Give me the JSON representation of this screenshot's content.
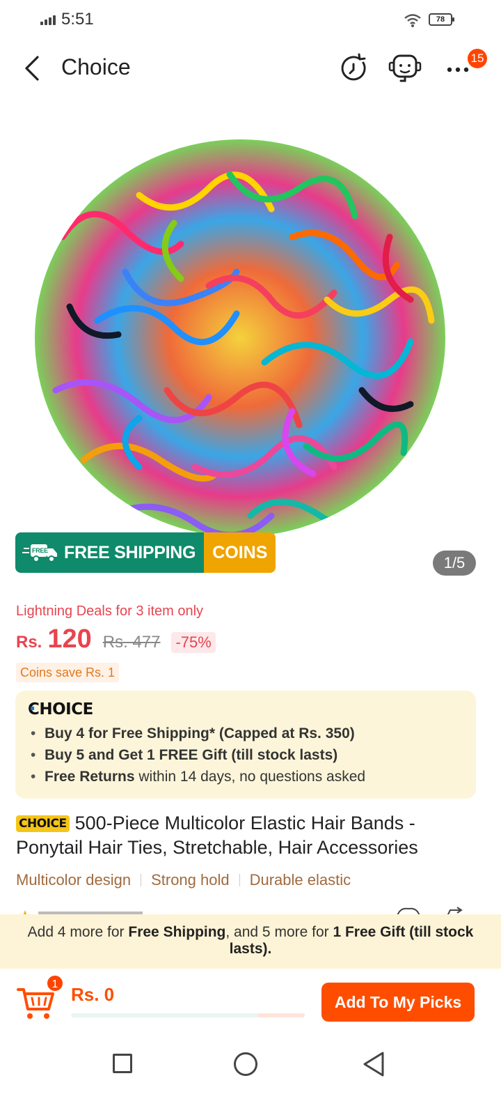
{
  "status_bar": {
    "time": "5:51",
    "battery": "78"
  },
  "header": {
    "title": "Choice",
    "badge_count": "15"
  },
  "gallery": {
    "counter": "1/5",
    "free_tag": "FREE",
    "free_shipping": "FREE SHIPPING",
    "coins": "COINS"
  },
  "price": {
    "deal_text": "Lightning Deals for 3 item only",
    "currency": "Rs.",
    "current": "120",
    "original": "Rs. 477",
    "discount": "-75%",
    "coins_save": "Coins save Rs. 1"
  },
  "choice_box": {
    "logo": "CHOICE",
    "items": [
      {
        "bold": "Buy 4 for  Free Shipping* (Capped at Rs. 350)",
        "rest": ""
      },
      {
        "bold": "Buy 5 and Get 1 FREE Gift (till stock lasts)",
        "rest": ""
      },
      {
        "bold": "Free Returns",
        "rest": " within 14 days, no questions asked"
      }
    ]
  },
  "product": {
    "tag": "CHOICE",
    "title": "500-Piece Multicolor Elastic Hair Bands - Ponytail Hair Ties, Stretchable, Hair Accessories",
    "features": [
      "Multicolor design",
      "Strong hold",
      "Durable elastic"
    ]
  },
  "bottom_promo": {
    "part1": "Add 4 more for ",
    "bold1": "Free Shipping",
    "part2": ", and 5 more for ",
    "bold2": "1 Free Gift (till stock lasts)."
  },
  "cart": {
    "badge": "1",
    "total": "Rs. 0",
    "progress": 0.8,
    "add_button": "Add To My Picks"
  },
  "colors": {
    "accent": "#ff4d00",
    "price": "#e8444f",
    "shipping_green": "#0f8a6a",
    "coins_orange": "#f0a400"
  }
}
